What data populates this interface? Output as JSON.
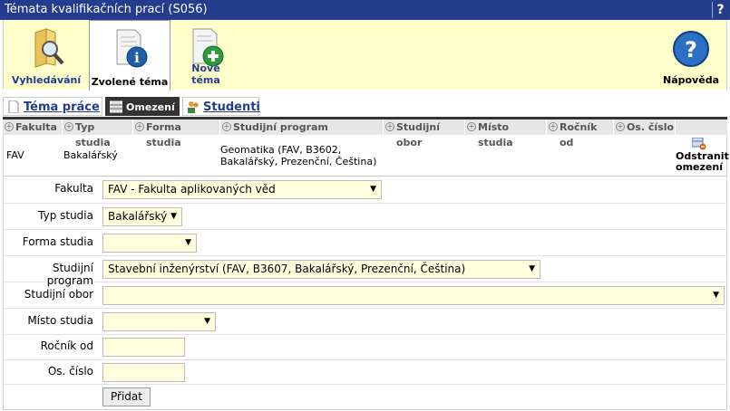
{
  "window": {
    "title": "Témata kvalifikačních prací (S056)",
    "help_char": "?"
  },
  "toolbar": {
    "search_label": "Vyhledávání",
    "selected_label": "Zvolené téma",
    "new_label": "Nové téma",
    "help_label": "Nápověda"
  },
  "tabs": {
    "topic": "Téma práce",
    "restrictions": "Omezení",
    "students": "Studenti"
  },
  "grid": {
    "headers": [
      "Fakulta",
      "Typ studia",
      "Forma studia",
      "Studijní program",
      "Studijní obor",
      "Místo studia",
      "Ročník od",
      "Os. číslo"
    ],
    "row": {
      "fakulta": "FAV",
      "typ": "Bakalářský",
      "program_line1": "Geomatika (FAV, B3602,",
      "program_line2": "Bakalářský, Prezenční, Čeština)",
      "remove_line1": "Odstranit",
      "remove_line2": "omezení"
    }
  },
  "form": {
    "fakulta_label": "Fakulta",
    "fakulta_value": "FAV - Fakulta aplikovaných věd",
    "typ_label": "Typ studia",
    "typ_value": "Bakalářský",
    "forma_label": "Forma studia",
    "forma_value": "",
    "program_label": "Studijní program",
    "program_value": "Stavební inženýrství (FAV, B3607, Bakalářský, Prezenční, Čeština)",
    "obor_label": "Studijní obor",
    "obor_value": "",
    "misto_label": "Místo studia",
    "misto_value": "",
    "rocnik_label": "Ročník od",
    "oscislo_label": "Os. číslo",
    "submit_label": "Přidat"
  },
  "colors": {
    "titlebar": "#253c8c",
    "toolbar": "#ffffcc",
    "field": "#ffffdd",
    "link": "#253c8c"
  }
}
